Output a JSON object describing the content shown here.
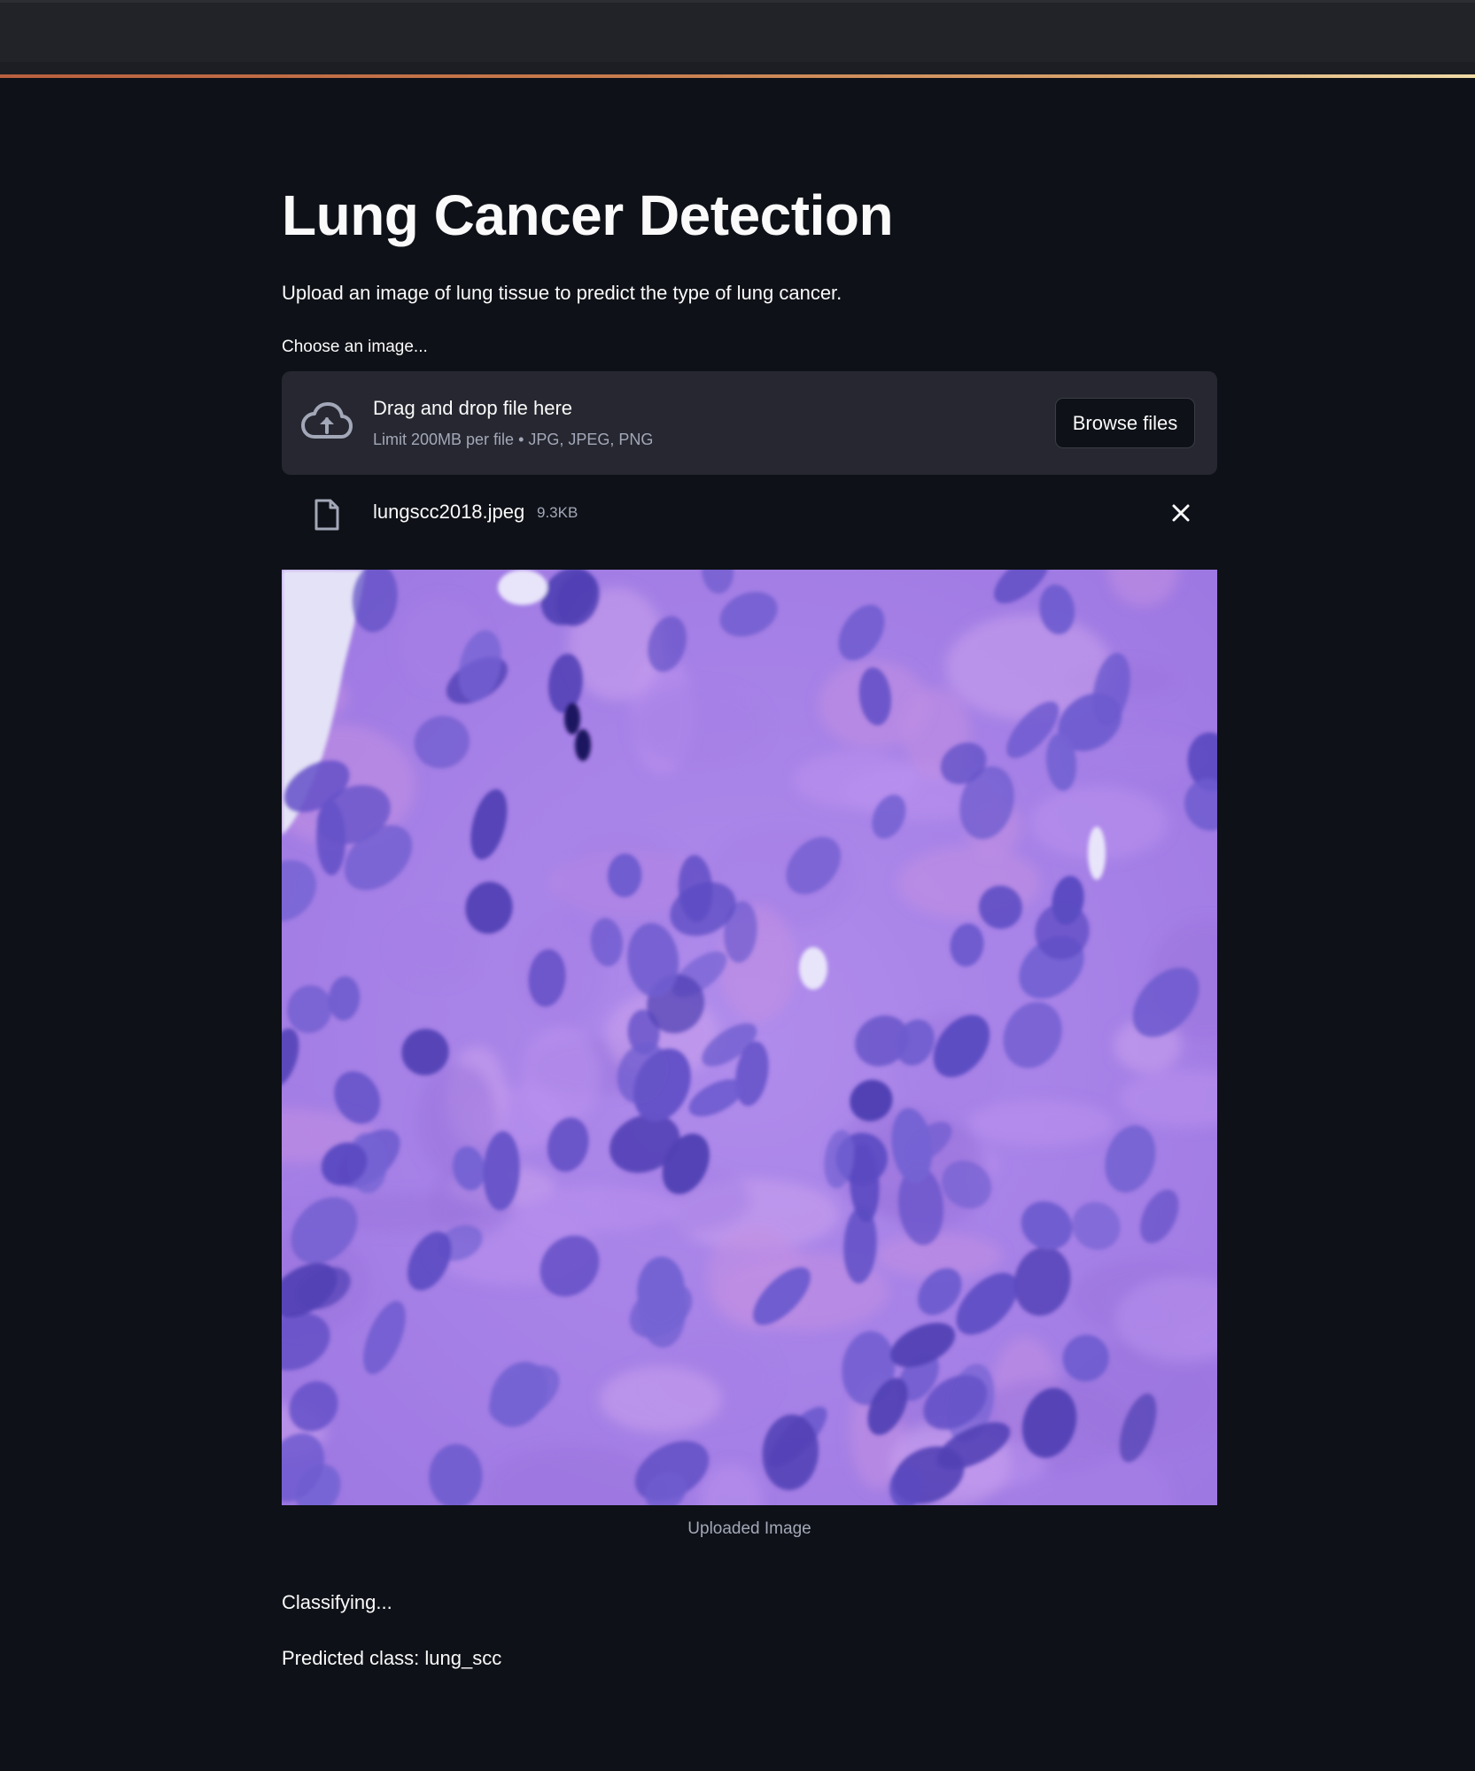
{
  "app": {
    "title": "Lung Cancer Detection",
    "subtitle": "Upload an image of lung tissue to predict the type of lung cancer."
  },
  "uploader": {
    "label": "Choose an image...",
    "drop_text": "Drag and drop file here",
    "limit_text": "Limit 200MB per file • JPG, JPEG, PNG",
    "browse_label": "Browse files",
    "upload_icon": "cloud-upload-icon"
  },
  "file": {
    "name": "lungscc2018.jpeg",
    "size": "9.3KB",
    "file_icon": "file-icon",
    "remove_icon": "close-icon"
  },
  "image": {
    "caption": "Uploaded Image"
  },
  "results": {
    "status": "Classifying...",
    "prediction": "Predicted class: lung_scc"
  },
  "colors": {
    "background": "#0e1117",
    "header": "#212329",
    "dropzone": "#262730",
    "text": "#fafafa",
    "muted_text": "#a3a8b8",
    "tissue_base": "#a883e8",
    "nucleus": "#5a48bd"
  }
}
